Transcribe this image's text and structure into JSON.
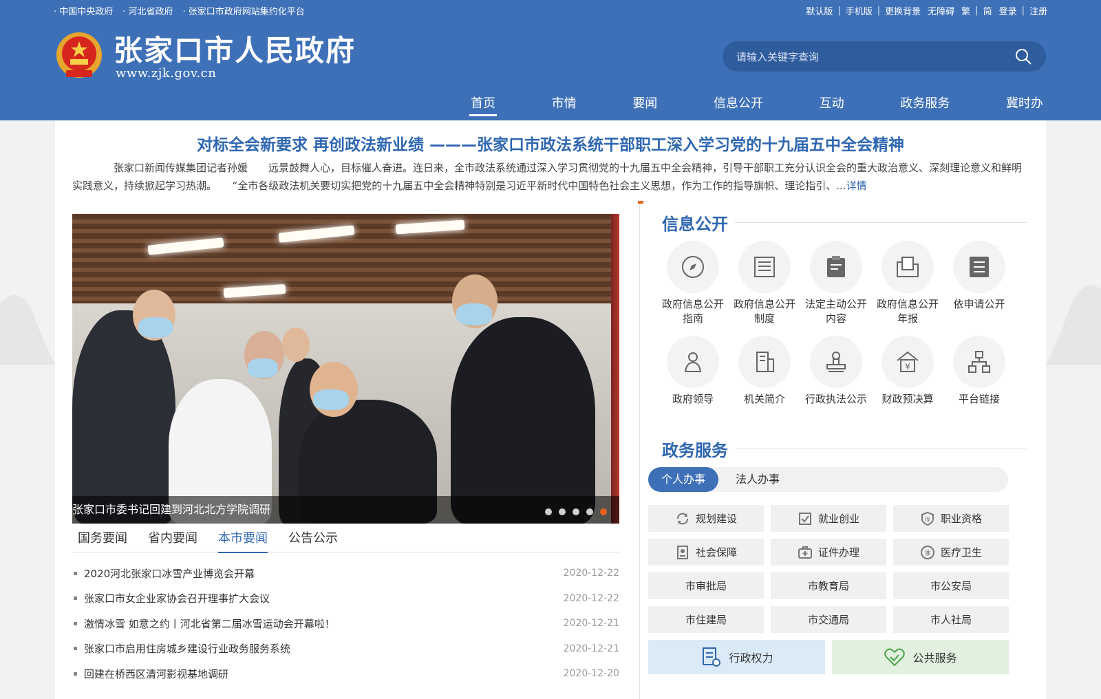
{
  "top_bar": {
    "left_links": [
      "· 中国中央政府",
      "· 河北省政府",
      "· 张家口市政府网站集约化平台"
    ],
    "right_links": [
      "默认版",
      "手机版",
      "更换背景",
      "无障碍",
      "繁",
      "简",
      "登录",
      "注册"
    ]
  },
  "header": {
    "title": "张家口市人民政府",
    "url": "www.zjk.gov.cn",
    "search_placeholder": "请输入关键字查询"
  },
  "nav": {
    "items": [
      "首页",
      "市情",
      "要闻",
      "信息公开",
      "互动",
      "政务服务",
      "冀时办"
    ],
    "active": "首页"
  },
  "feature": {
    "headline": "对标全会新要求 再创政法新业绩 ———张家口市政法系统干部职工深入学习党的十九届五中全会精神",
    "summary": "张家口新闻传媒集团记者孙媛　　远景鼓舞人心，目标催人奋进。连日来，全市政法系统通过深入学习贯彻党的十九届五中全会精神，引导干部职工充分认识全会的重大政治意义、深刻理论意义和鲜明实践意义，持续掀起学习热潮。　　“全市各级政法机关要切实把党的十九届五中全会精神特别是习近平新时代中国特色社会主义思想，作为工作的指导旗帜、理论指引、...",
    "more_label": "详情"
  },
  "slideshow": {
    "caption": "张家口市委书记回建到河北北方学院调研",
    "dot_count": 5,
    "active_dot": 5
  },
  "news": {
    "tabs": [
      "国务要闻",
      "省内要闻",
      "本市要闻",
      "公告公示"
    ],
    "active_tab": "本市要闻",
    "items": [
      {
        "title": "2020河北张家口冰雪产业博览会开幕",
        "date": "2020-12-22"
      },
      {
        "title": "张家口市女企业家协会召开理事扩大会议",
        "date": "2020-12-22"
      },
      {
        "title": "激情冰雪 如意之约丨河北省第二届冰雪运动会开幕啦！",
        "date": "2020-12-21"
      },
      {
        "title": "张家口市启用住房城乡建设行业政务服务系统",
        "date": "2020-12-21"
      },
      {
        "title": "回建在桥西区清河影视基地调研",
        "date": "2020-12-20"
      }
    ]
  },
  "info_public": {
    "title": "信息公开",
    "items": [
      {
        "label": "政府信息公开指南",
        "icon": "compass-icon"
      },
      {
        "label": "政府信息公开制度",
        "icon": "document-list-icon"
      },
      {
        "label": "法定主动公开内容",
        "icon": "clipboard-edit-icon"
      },
      {
        "label": "政府信息公开年报",
        "icon": "folder-document-icon"
      },
      {
        "label": "依申请公开",
        "icon": "list-icon"
      },
      {
        "label": "政府领导",
        "icon": "person-icon"
      },
      {
        "label": "机关简介",
        "icon": "building-icon"
      },
      {
        "label": "行政执法公示",
        "icon": "stamp-icon"
      },
      {
        "label": "财政预决算",
        "icon": "yuan-house-icon"
      },
      {
        "label": "平台链接",
        "icon": "network-icon"
      }
    ]
  },
  "gov_service": {
    "title": "政务服务",
    "tabs": [
      "个人办事",
      "法人办事"
    ],
    "active_tab": "个人办事",
    "buttons": [
      {
        "label": "规划建设",
        "icon": "refresh-icon"
      },
      {
        "label": "就业创业",
        "icon": "checkbox-icon"
      },
      {
        "label": "职业资格",
        "icon": "shield-badge-icon"
      },
      {
        "label": "社会保障",
        "icon": "id-card-icon"
      },
      {
        "label": "证件办理",
        "icon": "medical-bag-icon"
      },
      {
        "label": "医疗卫生",
        "icon": "medical-seal-icon"
      },
      {
        "label": "市审批局"
      },
      {
        "label": "市教育局"
      },
      {
        "label": "市公安局"
      },
      {
        "label": "市住建局"
      },
      {
        "label": "市交通局"
      },
      {
        "label": "市人社局"
      }
    ],
    "big_buttons": [
      {
        "label": "行政权力",
        "icon": "admin-doc-icon",
        "color": "#dbeaf7"
      },
      {
        "label": "公共服务",
        "icon": "handshake-heart-icon",
        "color": "#e1f0df"
      }
    ]
  },
  "colors": {
    "brand_blue": "#3e70b7",
    "accent_orange": "#e8631e"
  }
}
